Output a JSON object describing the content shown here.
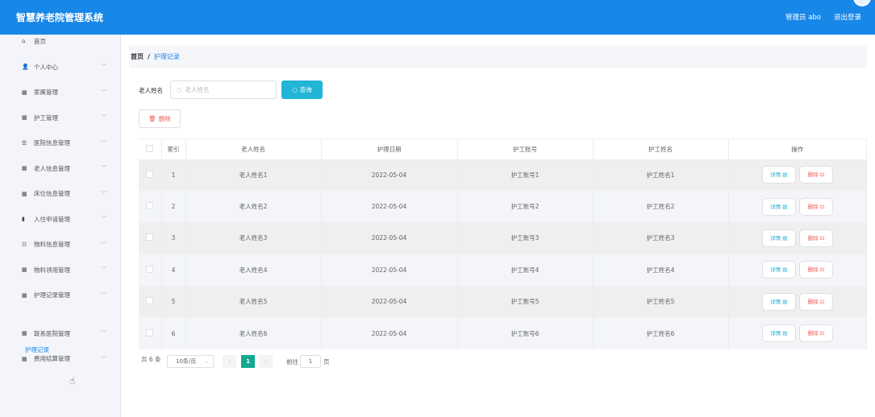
{
  "header": {
    "title": "智慧养老院管理系统",
    "user": "管理员 abo",
    "logout": "退出登录"
  },
  "sidebar": {
    "items": [
      {
        "label": "首页",
        "icon": "home-icon",
        "glyph": "⌂",
        "chev": false
      },
      {
        "label": "个人中心",
        "icon": "user-icon",
        "glyph": "👤",
        "chev": true
      },
      {
        "label": "家属管理",
        "icon": "grid-icon",
        "glyph": "▦",
        "chev": true
      },
      {
        "label": "护工管理",
        "icon": "grid-icon",
        "glyph": "▦",
        "chev": true
      },
      {
        "label": "医院信息管理",
        "icon": "list-icon",
        "glyph": "☰",
        "chev": true
      },
      {
        "label": "老人信息管理",
        "icon": "grid-icon",
        "glyph": "▦",
        "chev": true
      },
      {
        "label": "床位信息管理",
        "icon": "grid-icon",
        "glyph": "▦",
        "chev": true
      },
      {
        "label": "入住申请管理",
        "icon": "chart-icon",
        "glyph": "▮",
        "chev": true
      },
      {
        "label": "物料信息管理",
        "icon": "sliders-icon",
        "glyph": "☷",
        "chev": true
      },
      {
        "label": "物料领用管理",
        "icon": "grid-icon",
        "glyph": "▦",
        "chev": true
      },
      {
        "label": "护理记录管理",
        "icon": "grid-icon",
        "glyph": "▦",
        "chev": true
      },
      {
        "label": "联系医院管理",
        "icon": "grid-icon",
        "glyph": "▦",
        "chev": true
      },
      {
        "label": "费用结算管理",
        "icon": "grid-icon",
        "glyph": "▦",
        "chev": true
      }
    ],
    "sub": "护理记录"
  },
  "breadcrumb": {
    "home": "首页",
    "sep": "/",
    "current": "护理记录"
  },
  "search": {
    "label": "老人姓名",
    "placeholder": "老人姓名",
    "button": "查询"
  },
  "delete_button": "删除",
  "table": {
    "headers": [
      "索引",
      "老人姓名",
      "护理日期",
      "护工账号",
      "护工姓名",
      "操作"
    ],
    "rows": [
      [
        "1",
        "老人姓名1",
        "2022-05-04",
        "护工账号1",
        "护工姓名1"
      ],
      [
        "2",
        "老人姓名2",
        "2022-05-04",
        "护工账号2",
        "护工姓名2"
      ],
      [
        "3",
        "老人姓名3",
        "2022-05-04",
        "护工账号3",
        "护工姓名3"
      ],
      [
        "4",
        "老人姓名4",
        "2022-05-04",
        "护工账号4",
        "护工姓名4"
      ],
      [
        "5",
        "老人姓名5",
        "2022-05-04",
        "护工账号5",
        "护工姓名5"
      ],
      [
        "6",
        "老人姓名6",
        "2022-05-04",
        "护工账号6",
        "护工姓名6"
      ]
    ],
    "detail": "详情",
    "delete": "删除"
  },
  "pagination": {
    "total": "共 6 条",
    "page_size": "10条/页",
    "current": "1",
    "goto_label": "前往",
    "goto_value": "1",
    "page_suffix": "页"
  }
}
